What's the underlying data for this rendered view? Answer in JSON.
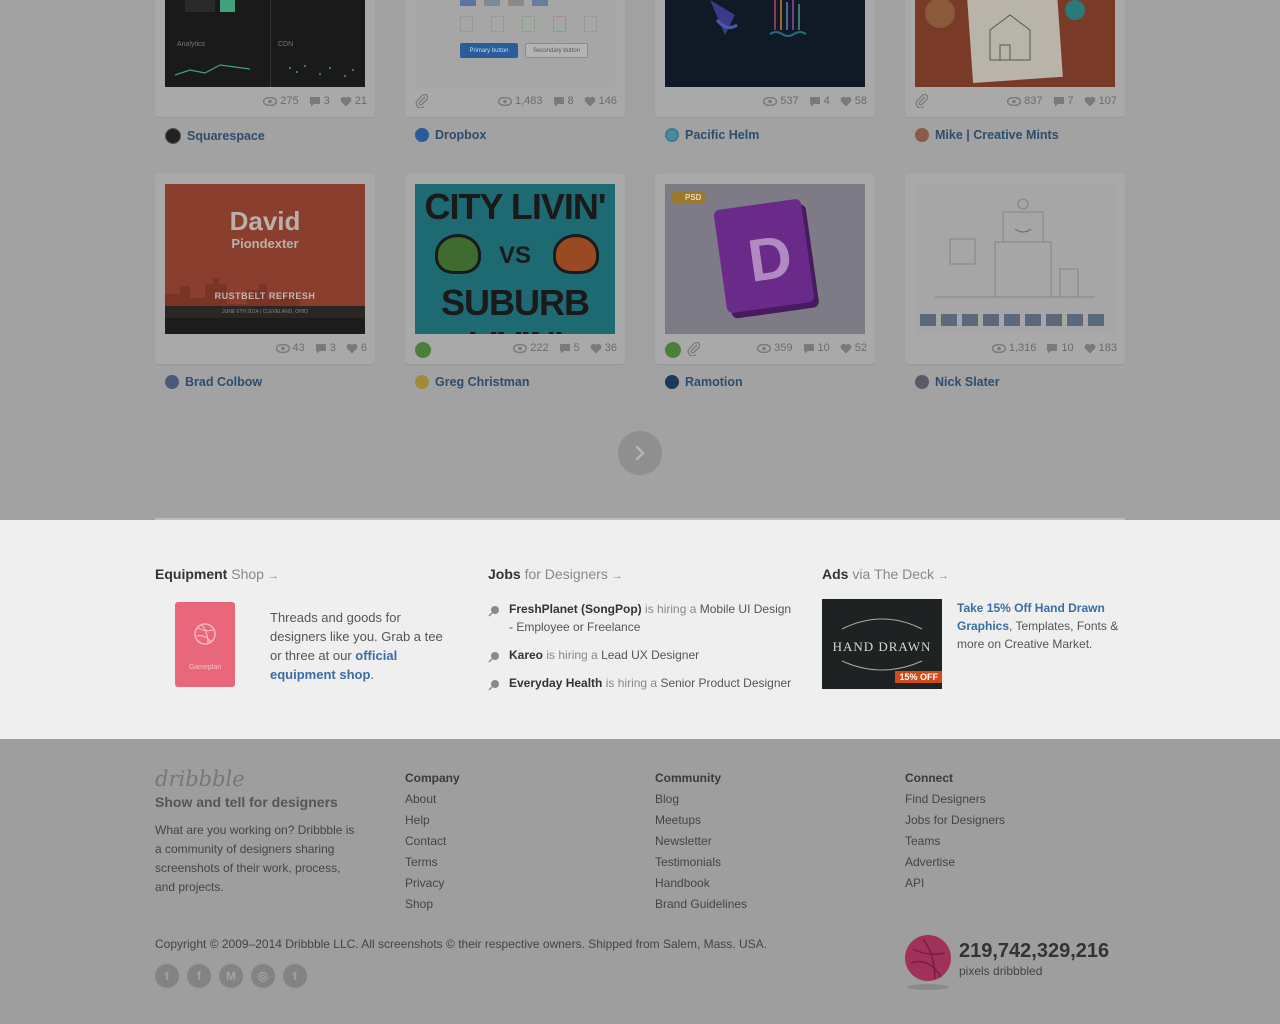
{
  "shots_row1": [
    {
      "views": "275",
      "comments": "3",
      "likes": "21",
      "player": "Squarespace",
      "has_attachment": false,
      "thumb_labels": [
        "Analytics",
        "CDN"
      ]
    },
    {
      "views": "1,483",
      "comments": "8",
      "likes": "146",
      "player": "Dropbox",
      "has_attachment": true,
      "thumb_labels": [
        "Primary button",
        "Secondary button"
      ]
    },
    {
      "views": "537",
      "comments": "4",
      "likes": "58",
      "player": "Pacific Helm",
      "has_attachment": false
    },
    {
      "views": "837",
      "comments": "7",
      "likes": "107",
      "player": "Mike | Creative Mints",
      "has_attachment": true
    }
  ],
  "shots_row2": [
    {
      "views": "43",
      "comments": "3",
      "likes": "6",
      "player": "Brad Colbow",
      "thumb_title": "David",
      "thumb_subtitle": "Piondexter",
      "thumb_banner": "RUSTBELT REFRESH",
      "thumb_date": "JUNE 6TH 2014 | CLEVELAND, OHIO"
    },
    {
      "views": "222",
      "comments": "5",
      "likes": "36",
      "player": "Greg Christman",
      "rebound": true,
      "thumb_top": "CITY LIVIN'",
      "thumb_vs": "VS",
      "thumb_bottom": "SUBURB LIVIN'"
    },
    {
      "views": "359",
      "comments": "10",
      "likes": "52",
      "player": "Ramotion",
      "rebound": true,
      "has_attachment": true,
      "badge": "PSD",
      "book_letter": "D"
    },
    {
      "views": "1,316",
      "comments": "10",
      "likes": "183",
      "player": "Nick Slater"
    }
  ],
  "promo": {
    "equipment": {
      "title_bold": "Equipment",
      "title_light": "Shop",
      "arrow": "→",
      "notebook_label": "Gameplan",
      "text_before": "Threads and goods for designers like you. Grab a tee or three at our ",
      "link": "official equipment shop",
      "text_after": "."
    },
    "jobs": {
      "title_bold": "Jobs",
      "title_light": "for Designers",
      "arrow": "→",
      "items": [
        {
          "company": "FreshPlanet (SongPop)",
          "mid": "is hiring a",
          "role": "Mobile UI Design - Employee or Freelance"
        },
        {
          "company": "Kareo",
          "mid": "is hiring a",
          "role": "Lead UX Designer"
        },
        {
          "company": "Everyday Health",
          "mid": "is hiring a",
          "role": "Senior Product Designer"
        }
      ]
    },
    "ads": {
      "title_bold": "Ads",
      "title_light": "via",
      "title_link": "The Deck",
      "arrow": "→",
      "image_title": "HAND DRAWN",
      "image_badge": "15% OFF",
      "link": "Take 15% Off Hand Drawn Graphics",
      "text": ", Templates, Fonts & more on Creative Market."
    }
  },
  "footer": {
    "logo": "dribbble",
    "tagline": "Show and tell for designers",
    "about_text": "What are you working on? Dribbble is a community of designers sharing screenshots of their work, process, and projects.",
    "company": {
      "title": "Company",
      "links": [
        "About",
        "Help",
        "Contact",
        "Terms",
        "Privacy",
        "Shop"
      ]
    },
    "community": {
      "title": "Community",
      "links": [
        "Blog",
        "Meetups",
        "Newsletter",
        "Testimonials",
        "Handbook",
        "Brand Guidelines"
      ]
    },
    "connect": {
      "title": "Connect",
      "links": [
        "Find Designers",
        "Jobs for Designers",
        "Teams",
        "Advertise",
        "API"
      ]
    },
    "copyright": "Copyright © 2009–2014 Dribbble LLC. All screenshots © their respective owners. Shipped from Salem, Mass. USA.",
    "social": [
      "t",
      "f",
      "M",
      "◎",
      "t"
    ],
    "pixel_count": "219,742,329,216",
    "pixel_label": "pixels dribbbled"
  },
  "colors": {
    "link": "#2e4d6b",
    "accent_pink": "#c2185b",
    "dribbble_pink": "#ea4c89"
  }
}
